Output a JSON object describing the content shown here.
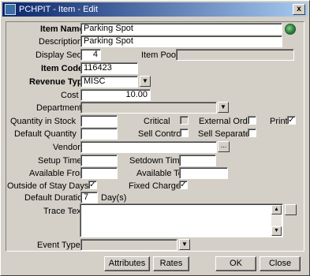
{
  "window": {
    "title": "PCHPIT - Item - Edit",
    "close_glyph": "x"
  },
  "form": {
    "item_name": {
      "label": "Item Name",
      "value": "Parking Spot"
    },
    "description": {
      "label": "Description",
      "value": "Parking Spot"
    },
    "display_seq": {
      "label": "Display Seq.",
      "value": "4"
    },
    "item_pool": {
      "label": "Item Pool",
      "value": ""
    },
    "item_code": {
      "label": "Item Code",
      "value": "116423"
    },
    "revenue_type": {
      "label": "Revenue Type",
      "value": "MISC"
    },
    "cost": {
      "label": "Cost",
      "value": "10.00"
    },
    "department": {
      "label": "Department",
      "value": ""
    },
    "quantity_in_stock": {
      "label": "Quantity in Stock",
      "value": ""
    },
    "critical": {
      "label": "Critical",
      "checked": false
    },
    "external_order": {
      "label": "External Order",
      "checked": false
    },
    "print": {
      "label": "Print",
      "checked": true
    },
    "default_quantity": {
      "label": "Default Quantity",
      "value": ""
    },
    "sell_control": {
      "label": "Sell Control",
      "checked": false
    },
    "sell_separate": {
      "label": "Sell Separate",
      "checked": false
    },
    "vendor": {
      "label": "Vendor",
      "value": ""
    },
    "setup_time": {
      "label": "Setup Time",
      "value": ""
    },
    "setdown_time": {
      "label": "Setdown Time",
      "value": ""
    },
    "available_from": {
      "label": "Available From",
      "value": ""
    },
    "available_to": {
      "label": "Available To",
      "value": ""
    },
    "outside_of_stay_days": {
      "label": "Outside of Stay Days",
      "checked": true
    },
    "fixed_charges": {
      "label": "Fixed Charges",
      "checked": true
    },
    "default_duration": {
      "label": "Default Duration",
      "value": "7",
      "unit": "Day(s)"
    },
    "trace_text": {
      "label": "Trace Text",
      "value": ""
    },
    "event_types": {
      "label": "Event Types",
      "value": ""
    }
  },
  "buttons": {
    "attributes": "Attributes",
    "rates": "Rates",
    "ok": "OK",
    "close": "Close"
  },
  "glyphs": {
    "dropdown": "▼",
    "ellipsis": "...",
    "check": "✓",
    "scroll_up": "▲",
    "scroll_down": "▼"
  },
  "colors": {
    "title_start": "#0a246a",
    "title_end": "#a6caf0",
    "face": "#d4d0c8"
  }
}
